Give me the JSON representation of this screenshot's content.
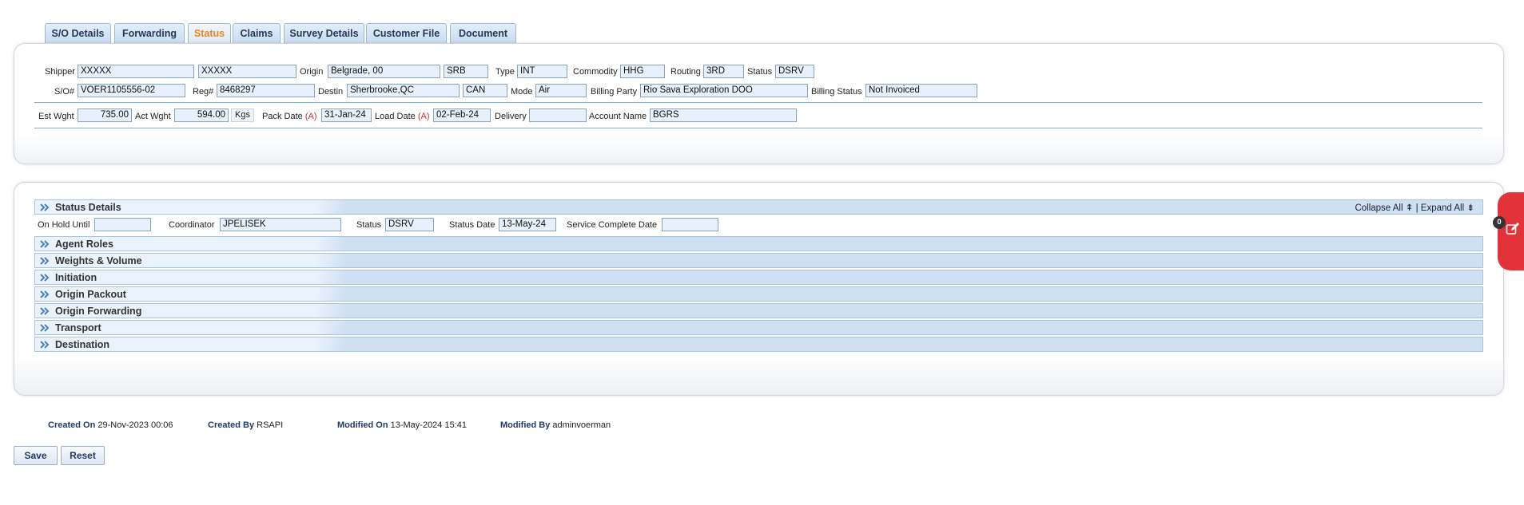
{
  "tabs": [
    {
      "label": "S/O Details",
      "active": false
    },
    {
      "label": "Forwarding",
      "active": false
    },
    {
      "label": "Status",
      "active": true
    },
    {
      "label": "Claims",
      "active": false
    },
    {
      "label": "Survey Details",
      "active": false
    },
    {
      "label": "Customer File",
      "active": false
    },
    {
      "label": "Document",
      "active": false
    }
  ],
  "header": {
    "shipper_label": "Shipper",
    "shipper_first": "XXXXX",
    "shipper_last": "XXXXX",
    "origin_label": "Origin",
    "origin_city": "Belgrade, 00",
    "origin_country": "SRB",
    "type_label": "Type",
    "type_value": "INT",
    "commodity_label": "Commodity",
    "commodity_value": "HHG",
    "routing_label": "Routing",
    "routing_value": "3RD",
    "status_label": "Status",
    "status_value": "DSRV",
    "so_label": "S/O#",
    "so_value": "VOER1105556-02",
    "reg_label": "Reg#",
    "reg_value": "8468297",
    "destin_label": "Destin",
    "destin_city": "Sherbrooke,QC",
    "destin_country": "CAN",
    "mode_label": "Mode",
    "mode_value": "Air",
    "billing_party_label": "Billing Party",
    "billing_party_value": "Rio Sava Exploration DOO",
    "billing_status_label": "Billing Status",
    "billing_status_value": "Not Invoiced",
    "est_wght_label": "Est Wght",
    "est_wght_value": "735.00",
    "act_wght_label": "Act Wght",
    "act_wght_value": "594.00",
    "weight_unit": "Kgs",
    "pack_date_label": "Pack Date",
    "pack_date_flag": "(A)",
    "pack_date_value": "31-Jan-24",
    "load_date_label": "Load Date",
    "load_date_flag": "(A)",
    "load_date_value": "02-Feb-24",
    "delivery_label": "Delivery",
    "delivery_value": "",
    "account_name_label": "Account Name",
    "account_name_value": "BGRS"
  },
  "status_details": {
    "title": "Status Details",
    "collapse_all": "Collapse All",
    "separator": "|",
    "expand_all": "Expand All",
    "on_hold_label": "On Hold Until",
    "on_hold_value": "",
    "coordinator_label": "Coordinator",
    "coordinator_value": "JPELISEK",
    "status_label": "Status",
    "status_value": "DSRV",
    "status_date_label": "Status Date",
    "status_date_value": "13-May-24",
    "service_complete_label": "Service Complete Date",
    "service_complete_value": ""
  },
  "sections": [
    "Agent Roles",
    "Weights & Volume",
    "Initiation",
    "Origin Packout",
    "Origin Forwarding",
    "Transport",
    "Destination"
  ],
  "audit": {
    "created_on_label": "Created On",
    "created_on_value": "29-Nov-2023 00:06",
    "created_by_label": "Created By",
    "created_by_value": "RSAPI",
    "modified_on_label": "Modified On",
    "modified_on_value": "13-May-2024 15:41",
    "modified_by_label": "Modified By",
    "modified_by_value": "adminvoerman"
  },
  "buttons": {
    "save": "Save",
    "reset": "Reset"
  },
  "notifications": {
    "count": "0"
  },
  "colors": {
    "accent_tab": "#e8862a",
    "badge": "#e2333a",
    "label_blue": "#1f3a66"
  }
}
